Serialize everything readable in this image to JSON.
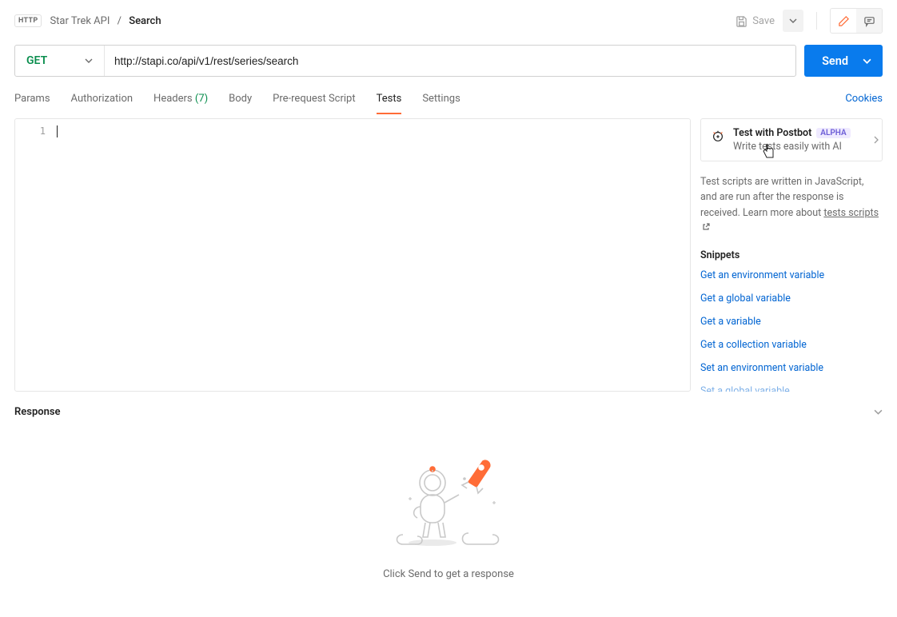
{
  "breadcrumb": {
    "badge": "HTTP",
    "parent": "Star Trek API",
    "current": "Search"
  },
  "topActions": {
    "save": "Save"
  },
  "request": {
    "method": "GET",
    "url": "http://stapi.co/api/v1/rest/series/search",
    "send": "Send"
  },
  "tabs": {
    "params": "Params",
    "authorization": "Authorization",
    "headers": "Headers",
    "headersCount": "(7)",
    "body": "Body",
    "prerequest": "Pre-request Script",
    "tests": "Tests",
    "settings": "Settings",
    "cookies": "Cookies"
  },
  "editor": {
    "lineNumber": "1"
  },
  "postbot": {
    "title": "Test with Postbot",
    "badge": "ALPHA",
    "subtitle": "Write tests easily with AI"
  },
  "sidebar": {
    "helpText": "Test scripts are written in JavaScript, and are run after the response is received. Learn more about ",
    "helpLink": "tests scripts",
    "snippetsTitle": "Snippets",
    "snippets": [
      "Get an environment variable",
      "Get a global variable",
      "Get a variable",
      "Get a collection variable",
      "Set an environment variable",
      "Set a global variable"
    ]
  },
  "response": {
    "title": "Response",
    "emptyText": "Click Send to get a response"
  }
}
